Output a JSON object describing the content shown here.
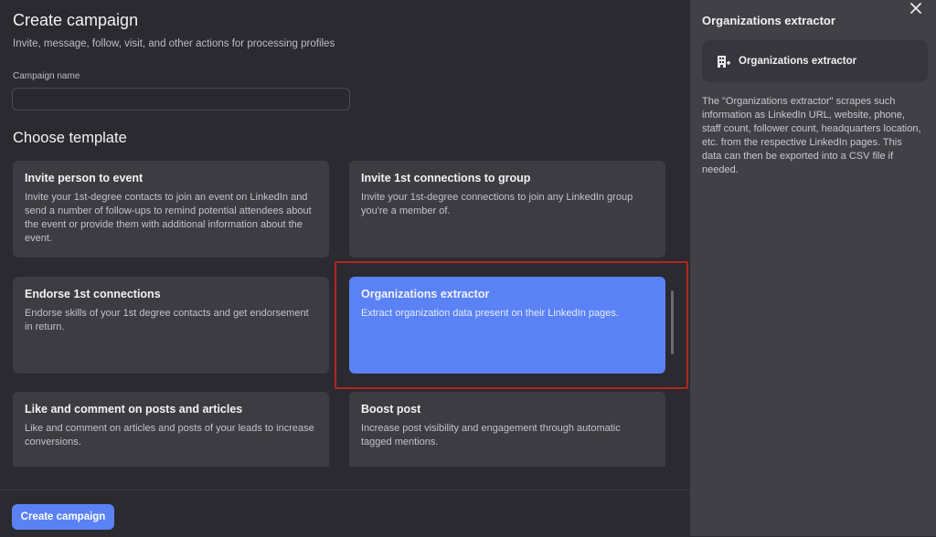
{
  "header": {
    "title": "Create campaign",
    "subtitle": "Invite, message, follow, visit, and other actions for processing profiles"
  },
  "campaign_name": {
    "label": "Campaign name",
    "value": "",
    "placeholder": ""
  },
  "templates": {
    "title": "Choose template",
    "items": [
      {
        "title": "Invite person to event",
        "desc": "Invite your 1st-degree contacts to join an event on LinkedIn and send a number of follow-ups to remind potential attendees about the event or provide them with additional information about the event."
      },
      {
        "title": "Invite 1st connections to group",
        "desc": "Invite your 1st-degree connections to join any LinkedIn group you're a member of."
      },
      {
        "title": "Endorse 1st connections",
        "desc": "Endorse skills of your 1st degree contacts and get endorsement in return."
      },
      {
        "title": "Organizations extractor",
        "desc": "Extract organization data present on their LinkedIn pages."
      },
      {
        "title": "Like and comment on posts and articles",
        "desc": "Like and comment on articles and posts of your leads to increase conversions."
      },
      {
        "title": "Boost post",
        "desc": "Increase post visibility and engagement through automatic tagged mentions."
      }
    ],
    "selected": "Organizations extractor"
  },
  "footer": {
    "create_label": "Create campaign"
  },
  "panel": {
    "title": "Organizations extractor",
    "chip_label": "Organizations extractor",
    "chip_icon": "building-icon",
    "close_icon": "close-icon",
    "description": "The \"Organizations extractor\" scrapes such information as LinkedIn URL, website, phone, staff count, follower count, headquarters location, etc. from the respective LinkedIn pages. This data can then be exported into a CSV file if needed."
  },
  "colors": {
    "accent": "#5a82f5",
    "highlight_border": "#b3261e",
    "card": "#3c3c42",
    "background": "#2a2a30",
    "panel": "#404046"
  }
}
